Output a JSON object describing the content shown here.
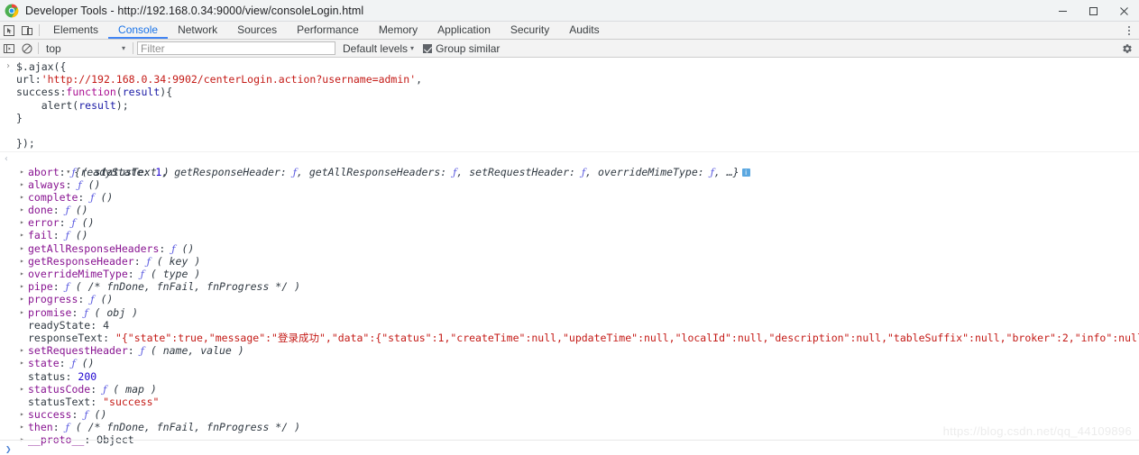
{
  "window": {
    "title": "Developer Tools - http://192.168.0.34:9000/view/consoleLogin.html",
    "minimize_label": "—",
    "maximize_label": "□",
    "close_label": "✕"
  },
  "tabbar": {
    "inspect_icon": "inspect-element-icon",
    "device_icon": "device-toolbar-icon",
    "more_icon": "more-options-icon",
    "tabs": [
      {
        "label": "Elements",
        "active": false
      },
      {
        "label": "Console",
        "active": true
      },
      {
        "label": "Network",
        "active": false
      },
      {
        "label": "Sources",
        "active": false
      },
      {
        "label": "Performance",
        "active": false
      },
      {
        "label": "Memory",
        "active": false
      },
      {
        "label": "Application",
        "active": false
      },
      {
        "label": "Security",
        "active": false
      },
      {
        "label": "Audits",
        "active": false
      }
    ]
  },
  "filterbar": {
    "sidebar_icon": "console-sidebar-icon",
    "clear_icon": "clear-console-icon",
    "context": "top",
    "context_caret": "▾",
    "filter_placeholder": "Filter",
    "filter_value": "",
    "levels_label": "Default levels",
    "levels_caret": "▾",
    "group_similar_label": "Group similar",
    "group_similar_checked": true,
    "settings_icon": "settings-gear-icon"
  },
  "console": {
    "input_prompt": "›",
    "input_lines": [
      [
        {
          "t": "$.ajax({",
          "c": "c-plain"
        }
      ],
      [
        {
          "t": "url:",
          "c": "c-plain"
        },
        {
          "t": "'http://192.168.0.34:9902/centerLogin.action?username=admin'",
          "c": "c-string"
        },
        {
          "t": ",",
          "c": "c-plain"
        }
      ],
      [
        {
          "t": "success:",
          "c": "c-plain"
        },
        {
          "t": "function",
          "c": "c-keyword"
        },
        {
          "t": "(",
          "c": "c-plain"
        },
        {
          "t": "result",
          "c": "c-blue"
        },
        {
          "t": "){",
          "c": "c-plain"
        }
      ],
      [
        {
          "t": "    alert(",
          "c": "c-plain"
        },
        {
          "t": "result",
          "c": "c-blue"
        },
        {
          "t": ");",
          "c": "c-plain"
        }
      ],
      [
        {
          "t": "}",
          "c": "c-plain"
        }
      ],
      [
        {
          "t": "",
          "c": "c-plain"
        }
      ],
      [
        {
          "t": "});",
          "c": "c-plain"
        }
      ]
    ],
    "result_arrow": "‹",
    "result_toggle": "▾",
    "summary": [
      {
        "t": "{readyState: ",
        "c": "c-objsum"
      },
      {
        "t": "1",
        "c": "c-num"
      },
      {
        "t": ", getResponseHeader: ",
        "c": "c-objsum"
      },
      {
        "t": "ƒ",
        "c": "fn-mark"
      },
      {
        "t": ", getAllResponseHeaders: ",
        "c": "c-objsum"
      },
      {
        "t": "ƒ",
        "c": "fn-mark"
      },
      {
        "t": ", setRequestHeader: ",
        "c": "c-objsum"
      },
      {
        "t": "ƒ",
        "c": "fn-mark"
      },
      {
        "t": ", overrideMimeType: ",
        "c": "c-objsum"
      },
      {
        "t": "ƒ",
        "c": "fn-mark"
      },
      {
        "t": ", …}",
        "c": "c-objsum"
      }
    ],
    "summary_info_icon": "i",
    "properties": [
      {
        "toggle": "▸",
        "name": "abort",
        "value": [
          {
            "t": "ƒ",
            "c": "fn-mark"
          },
          {
            "t": " ( ",
            "c": "c-param"
          },
          {
            "t": "statusText",
            "c": "c-param"
          },
          {
            "t": " )",
            "c": "c-param"
          }
        ]
      },
      {
        "toggle": "▸",
        "name": "always",
        "value": [
          {
            "t": "ƒ",
            "c": "fn-mark"
          },
          {
            "t": " ()",
            "c": "c-param"
          }
        ]
      },
      {
        "toggle": "▸",
        "name": "complete",
        "value": [
          {
            "t": "ƒ",
            "c": "fn-mark"
          },
          {
            "t": " ()",
            "c": "c-param"
          }
        ]
      },
      {
        "toggle": "▸",
        "name": "done",
        "value": [
          {
            "t": "ƒ",
            "c": "fn-mark"
          },
          {
            "t": " ()",
            "c": "c-param"
          }
        ]
      },
      {
        "toggle": "▸",
        "name": "error",
        "value": [
          {
            "t": "ƒ",
            "c": "fn-mark"
          },
          {
            "t": " ()",
            "c": "c-param"
          }
        ]
      },
      {
        "toggle": "▸",
        "name": "fail",
        "value": [
          {
            "t": "ƒ",
            "c": "fn-mark"
          },
          {
            "t": " ()",
            "c": "c-param"
          }
        ]
      },
      {
        "toggle": "▸",
        "name": "getAllResponseHeaders",
        "value": [
          {
            "t": "ƒ",
            "c": "fn-mark"
          },
          {
            "t": " ()",
            "c": "c-param"
          }
        ]
      },
      {
        "toggle": "▸",
        "name": "getResponseHeader",
        "value": [
          {
            "t": "ƒ",
            "c": "fn-mark"
          },
          {
            "t": " ( ",
            "c": "c-param"
          },
          {
            "t": "key",
            "c": "c-param"
          },
          {
            "t": " )",
            "c": "c-param"
          }
        ]
      },
      {
        "toggle": "▸",
        "name": "overrideMimeType",
        "value": [
          {
            "t": "ƒ",
            "c": "fn-mark"
          },
          {
            "t": " ( ",
            "c": "c-param"
          },
          {
            "t": "type",
            "c": "c-param"
          },
          {
            "t": " )",
            "c": "c-param"
          }
        ]
      },
      {
        "toggle": "▸",
        "name": "pipe",
        "value": [
          {
            "t": "ƒ",
            "c": "fn-mark"
          },
          {
            "t": " ( /* fnDone, fnFail, fnProgress */ )",
            "c": "c-param"
          }
        ]
      },
      {
        "toggle": "▸",
        "name": "progress",
        "value": [
          {
            "t": "ƒ",
            "c": "fn-mark"
          },
          {
            "t": " ()",
            "c": "c-param"
          }
        ]
      },
      {
        "toggle": "▸",
        "name": "promise",
        "value": [
          {
            "t": "ƒ",
            "c": "fn-mark"
          },
          {
            "t": " ( ",
            "c": "c-param"
          },
          {
            "t": "obj",
            "c": "c-param"
          },
          {
            "t": " )",
            "c": "c-param"
          }
        ]
      },
      {
        "toggle": "",
        "name": "readyState",
        "plain_name": true,
        "value": [
          {
            "t": "4",
            "c": "c-plain"
          }
        ]
      },
      {
        "toggle": "",
        "name": "responseText",
        "plain_name": true,
        "value": [
          {
            "t": "\"{\"state\":true,\"message\":\"登录成功\",\"data\":{\"status\":1,\"createTime\":null,\"updateTime\":null,\"localId\":null,\"description\":null,\"tableSuffix\":null,\"broker\":2,\"info\":null,\"userid",
            "c": "c-string"
          }
        ]
      },
      {
        "toggle": "▸",
        "name": "setRequestHeader",
        "value": [
          {
            "t": "ƒ",
            "c": "fn-mark"
          },
          {
            "t": " ( ",
            "c": "c-param"
          },
          {
            "t": "name, value",
            "c": "c-param"
          },
          {
            "t": " )",
            "c": "c-param"
          }
        ]
      },
      {
        "toggle": "▸",
        "name": "state",
        "value": [
          {
            "t": "ƒ",
            "c": "fn-mark"
          },
          {
            "t": " ()",
            "c": "c-param"
          }
        ]
      },
      {
        "toggle": "",
        "name": "status",
        "plain_name": true,
        "value": [
          {
            "t": "200",
            "c": "c-num"
          }
        ]
      },
      {
        "toggle": "▸",
        "name": "statusCode",
        "value": [
          {
            "t": "ƒ",
            "c": "fn-mark"
          },
          {
            "t": " ( ",
            "c": "c-param"
          },
          {
            "t": "map",
            "c": "c-param"
          },
          {
            "t": " )",
            "c": "c-param"
          }
        ]
      },
      {
        "toggle": "",
        "name": "statusText",
        "plain_name": true,
        "value": [
          {
            "t": "\"success\"",
            "c": "c-string"
          }
        ]
      },
      {
        "toggle": "▸",
        "name": "success",
        "value": [
          {
            "t": "ƒ",
            "c": "fn-mark"
          },
          {
            "t": " ()",
            "c": "c-param"
          }
        ]
      },
      {
        "toggle": "▸",
        "name": "then",
        "value": [
          {
            "t": "ƒ",
            "c": "fn-mark"
          },
          {
            "t": " ( /* fnDone, fnFail, fnProgress */ )",
            "c": "c-param"
          }
        ]
      },
      {
        "toggle": "▸",
        "name": "__proto__",
        "value": [
          {
            "t": "Object",
            "c": "c-plain"
          }
        ]
      }
    ],
    "bottom_prompt": "❯"
  },
  "watermark": "https://blog.csdn.net/qq_44109896",
  "colors": {
    "accent": "#1a73e8",
    "string": "#c41a16",
    "keyword": "#aa0d91",
    "number": "#1c00cf",
    "property": "#881391",
    "function": "#5c5ce0",
    "titlebar_bg": "#f1f3f4",
    "toolbar_bg": "#f3f3f3"
  }
}
